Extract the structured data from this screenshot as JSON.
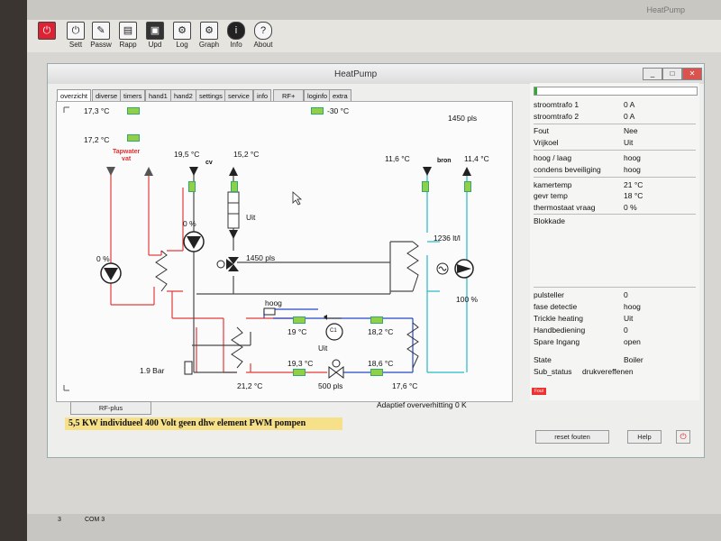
{
  "app": {
    "title": "HeatPump",
    "window_title": "HeatPump",
    "toolbar": [
      {
        "label": "Sett",
        "icon": "power-icon"
      },
      {
        "label": "Passw",
        "icon": "pencil-icon"
      },
      {
        "label": "Rapp",
        "icon": "document-icon"
      },
      {
        "label": "Upd",
        "icon": "floppy-icon"
      },
      {
        "label": "Log",
        "icon": "gear-icon"
      },
      {
        "label": "Graph",
        "icon": "gear-icon"
      },
      {
        "label": "Info",
        "icon": "info-icon"
      },
      {
        "label": "About",
        "icon": "question-icon"
      }
    ]
  },
  "tabs": [
    "overzicht",
    "diverse",
    "timers",
    "hand1",
    "hand2",
    "settings",
    "service",
    "info",
    "RF+",
    "loginfo",
    "extra"
  ],
  "diagram": {
    "t_top_left": "17,3 °C",
    "t_mid_left": "17,2 °C",
    "t_top_center": "-30 °C",
    "pls_top": "1450 pls",
    "tapwater_label": "Tapwater\nvat",
    "cv_temp1": "19,5 °C",
    "cv_label": "cv",
    "cv_temp2": "15,2 °C",
    "bron_temp1": "11,6 °C",
    "bron_label": "bron",
    "bron_temp2": "11,4 °C",
    "pump_cv_pct": "0 %",
    "valve_state": "Uit",
    "valve_pls": "1450 pls",
    "pump_tap_pct": "0 %",
    "flow": "1236 lt/l",
    "pump_bron_pct": "100 %",
    "hoog": "hoog",
    "comp_t1": "19 °C",
    "comp_t2": "18,2 °C",
    "comp_label": "C1",
    "comp_state": "Uit",
    "comp_t3": "19,3 °C",
    "comp_t4": "18,6 °C",
    "bar": "1.9 Bar",
    "t_bottom": "21,2 °C",
    "pls_bottom": "500 pls",
    "t_bottom_right": "17,6 °C",
    "adaptief": "Adaptief oververhitting 0 K",
    "rf_button": "RF-plus"
  },
  "right_panel": {
    "rows1": [
      {
        "label": "stroomtrafo 1",
        "value": "0 A"
      },
      {
        "label": "stroomtrafo 2",
        "value": "0 A"
      },
      {
        "label": "Fout",
        "value": "Nee"
      },
      {
        "label": "Vrijkoel",
        "value": "Uit"
      },
      {
        "label": "hoog / laag",
        "value": "hoog"
      },
      {
        "label": "condens beveiliging",
        "value": "hoog"
      },
      {
        "label": "kamertemp",
        "value": "21 °C"
      },
      {
        "label": "gevr temp",
        "value": "18 °C"
      },
      {
        "label": "thermostaat vraag",
        "value": "0 %"
      },
      {
        "label": "Blokkade",
        "value": ""
      }
    ],
    "rows2": [
      {
        "label": "pulsteller",
        "value": "0"
      },
      {
        "label": "fase detectie",
        "value": "hoog"
      },
      {
        "label": "Trickle heating",
        "value": "Uit"
      },
      {
        "label": "Handbediening",
        "value": "0"
      },
      {
        "label": "Spare Ingang",
        "value": "open"
      }
    ],
    "state_label": "State",
    "state_value": "Boiler",
    "sub_label": "Sub_status",
    "sub_value": "drukvereffenen",
    "fault_badge": "Fout",
    "reset_button": "reset fouten",
    "help_button": "Help"
  },
  "status_bar": "5,5 KW   individueel  400 Volt   geen dhw element   PWM pompen",
  "bottom": {
    "page": "3",
    "com": "COM 3"
  },
  "colors": {
    "hot": "#e23b3b",
    "cold": "#27b8c9",
    "blue": "#2546c7",
    "gray": "#4a4a4a",
    "green": "#8fd04a"
  }
}
